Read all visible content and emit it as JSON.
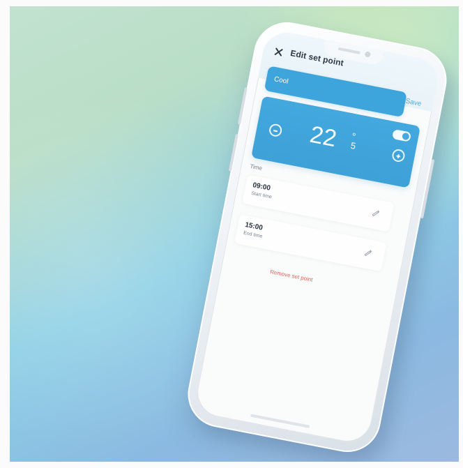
{
  "header": {
    "title": "Edit set point",
    "save_label": "Save",
    "close_icon": "close-icon"
  },
  "mode": {
    "label": "Cool",
    "enabled": true
  },
  "temperature": {
    "whole": "22",
    "decimal": "5",
    "degree_symbol": "°",
    "minus_icon": "minus-circle-icon",
    "plus_icon": "plus-circle-icon"
  },
  "schedule": {
    "section_label": "Time",
    "start": {
      "value": "09:00",
      "caption": "Start time",
      "edit_icon": "edit-icon"
    },
    "end": {
      "value": "15:00",
      "caption": "End time",
      "edit_icon": "edit-icon"
    }
  },
  "actions": {
    "remove_label": "Remove set point"
  },
  "colors": {
    "primary": "#3ea4dc",
    "danger": "#dc6358",
    "text_dark": "#2f3845",
    "text_muted": "#7a8490",
    "screen_background": "#fafbfb"
  }
}
